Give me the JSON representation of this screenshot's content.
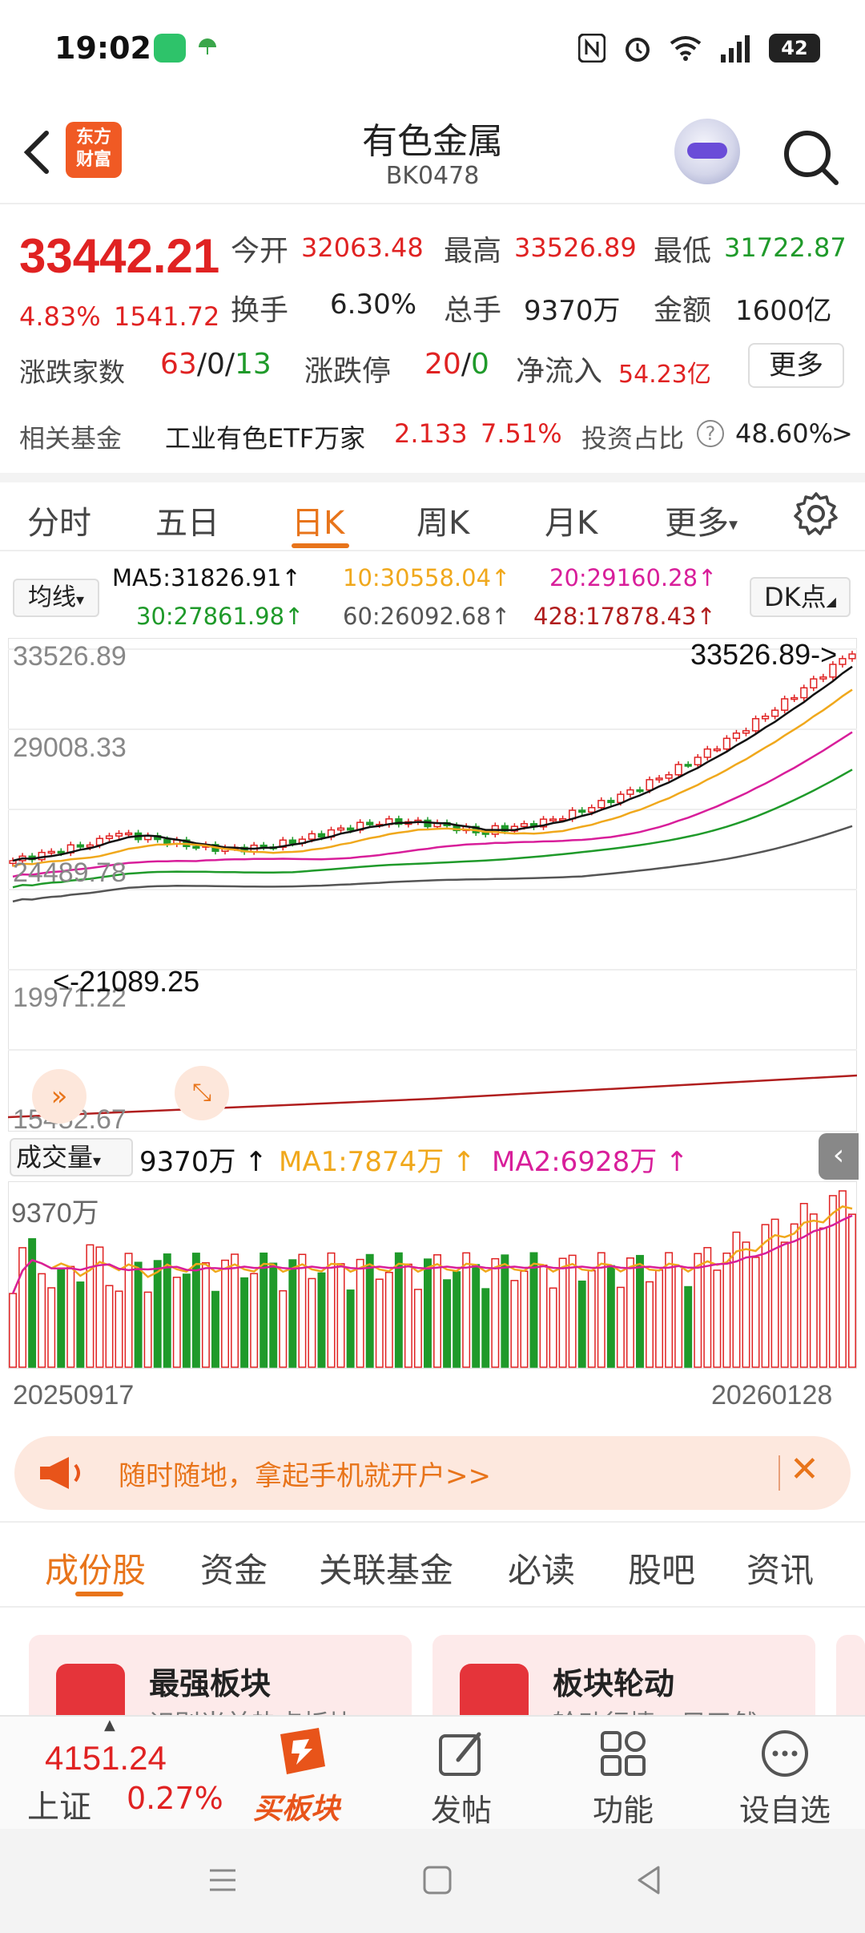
{
  "status": {
    "time": "19:02",
    "battery": "42"
  },
  "header": {
    "title": "有色金属",
    "code": "BK0478",
    "logo_line1": "东方",
    "logo_line2": "财富"
  },
  "quote": {
    "price": "33442.21",
    "pct": "4.83%",
    "change": "1541.72",
    "open_label": "今开",
    "open": "32063.48",
    "high_label": "最高",
    "high": "33526.89",
    "low_label": "最低",
    "low": "31722.87",
    "turnover_label": "换手",
    "turnover": "6.30%",
    "volume_label": "总手",
    "volume": "9370万",
    "amount_label": "金额",
    "amount": "1600亿",
    "breadth_label": "涨跌家数",
    "breadth_up": "63",
    "breadth_flat": "0",
    "breadth_down": "13",
    "slash": "/",
    "limit_label": "涨跌停",
    "limit_up": "20",
    "limit_down": "0",
    "inflow_label": "净流入",
    "inflow": "54.23亿",
    "more": "更多"
  },
  "fund": {
    "label": "相关基金",
    "name": "工业有色ETF万家",
    "price": "2.133",
    "pct": "7.51%",
    "ratio_label": "投资占比",
    "ratio": "48.60%",
    "arrow": ">"
  },
  "periods": {
    "tabs": [
      "分时",
      "五日",
      "日K",
      "周K",
      "月K",
      "更多"
    ],
    "active": 2
  },
  "ma": {
    "button": "均线",
    "ma5": "MA5:31826.91↑",
    "ma10": "10:30558.04↑",
    "ma20": "20:29160.28↑",
    "ma30": "30:27861.98↑",
    "ma60": "60:26092.68↑",
    "ma428": "428:17878.43↑",
    "dk": "DK点"
  },
  "kchart_labels": {
    "y1": "33526.89",
    "y2": "29008.33",
    "y3": "24489.78",
    "y4": "19971.22",
    "y5": "15452.67",
    "high_mark": "33526.89->",
    "low_mark": "<-21089.25"
  },
  "volume": {
    "button": "成交量",
    "value": "9370万 ↑",
    "ma1": "MA1:7874万 ↑",
    "ma2": "MA2:6928万 ↑",
    "ylabel": "9370万",
    "date_start": "20250917",
    "date_end": "20260128"
  },
  "banner": {
    "text": "随时随地，拿起手机就开户>>",
    "close": "✕"
  },
  "content_tabs": [
    "成份股",
    "资金",
    "关联基金",
    "必读",
    "股吧",
    "资讯"
  ],
  "cards": [
    {
      "title": "最强板块",
      "subtitle": "识别当前热点板块"
    },
    {
      "title": "板块轮动",
      "subtitle": "轮动行情一目了然"
    }
  ],
  "bottom_nav": {
    "index_value": "4151.24",
    "index_name": "上证",
    "index_pct": "0.27%",
    "brand": "买板块",
    "post": "发帖",
    "func": "功能",
    "watch": "设自选"
  },
  "colors": {
    "up": "#e02222",
    "down": "#1f9a2a",
    "accent": "#e8741a",
    "ma5": "#111111",
    "ma10": "#f0a81c",
    "ma20": "#d81e9a",
    "ma30": "#1f9a2a",
    "ma60": "#555555",
    "ma428": "#b01e1e"
  }
}
